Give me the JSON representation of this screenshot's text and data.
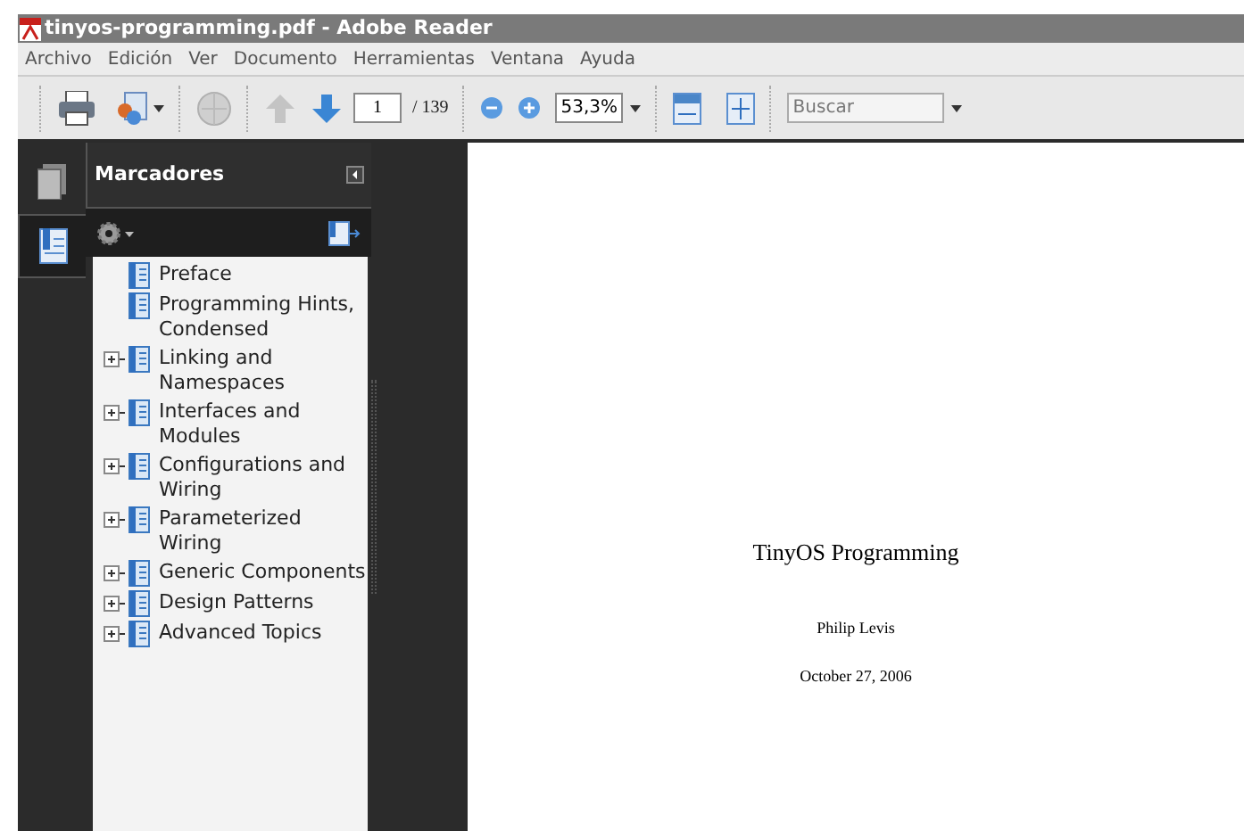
{
  "window": {
    "title": "tinyos-programming.pdf - Adobe Reader"
  },
  "menu": [
    "Archivo",
    "Edición",
    "Ver",
    "Documento",
    "Herramientas",
    "Ventana",
    "Ayuda"
  ],
  "toolbar": {
    "page": "1",
    "page_total": "/ 139",
    "zoom": "53,3%",
    "search": {
      "placeholder": "Buscar"
    }
  },
  "sidebar": {
    "title": "Marcadores",
    "tabs": [
      {
        "kind": "pages",
        "selected": false
      },
      {
        "kind": "bookmarks",
        "selected": true
      }
    ],
    "bookmarks": [
      {
        "label": "Preface",
        "expandable": false
      },
      {
        "label": "Programming Hints, Condensed",
        "expandable": false
      },
      {
        "label": "Linking and Namespaces",
        "expandable": true
      },
      {
        "label": "Interfaces and Modules",
        "expandable": true
      },
      {
        "label": "Configurations and Wiring",
        "expandable": true
      },
      {
        "label": "Parameterized Wiring",
        "expandable": true
      },
      {
        "label": "Generic Components",
        "expandable": true
      },
      {
        "label": "Design Patterns",
        "expandable": true
      },
      {
        "label": "Advanced Topics",
        "expandable": true
      }
    ]
  },
  "document": {
    "title": "TinyOS Programming",
    "author": "Philip Levis",
    "date": "October 27, 2006"
  }
}
